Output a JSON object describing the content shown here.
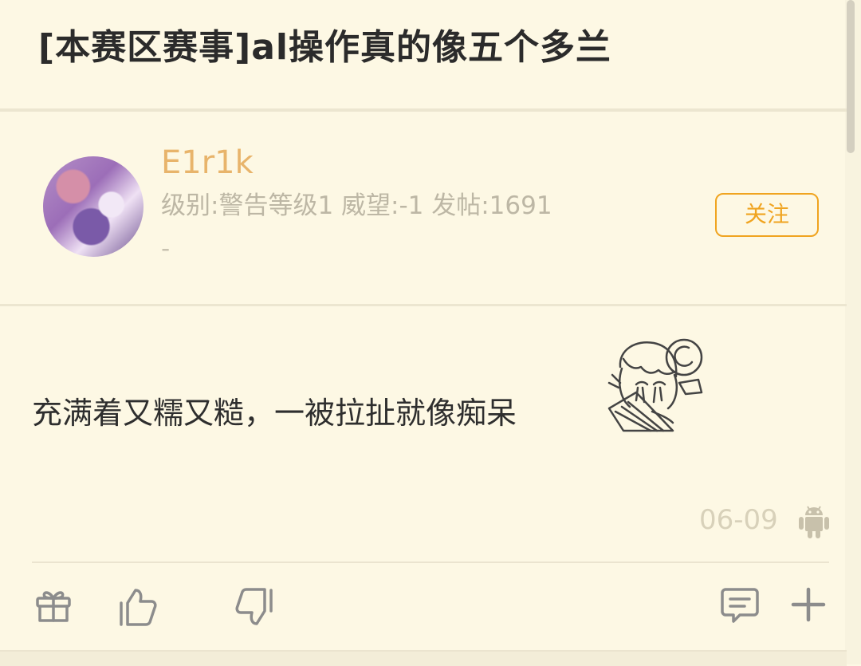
{
  "post": {
    "title": "[本赛区赛事]al操作真的像五个多兰"
  },
  "author": {
    "name": "E1r1k",
    "meta": "级别:警告等级1 威望:-1 发帖:1691",
    "extra": "-",
    "follow_label": "关注"
  },
  "reply": {
    "text": "充满着又糯又糙，一被拉扯就像痴呆",
    "date": "06-09",
    "platform_icon": "android-icon"
  },
  "actions": {
    "gift_icon": "gift-icon",
    "like_icon": "thumbs-up-icon",
    "dislike_icon": "thumbs-down-icon",
    "comment_icon": "comment-icon",
    "more_icon": "plus-icon"
  },
  "colors": {
    "background": "#fdf8e4",
    "accent": "#f0a420",
    "username": "#e8b46b",
    "muted": "#bdb7a5"
  }
}
